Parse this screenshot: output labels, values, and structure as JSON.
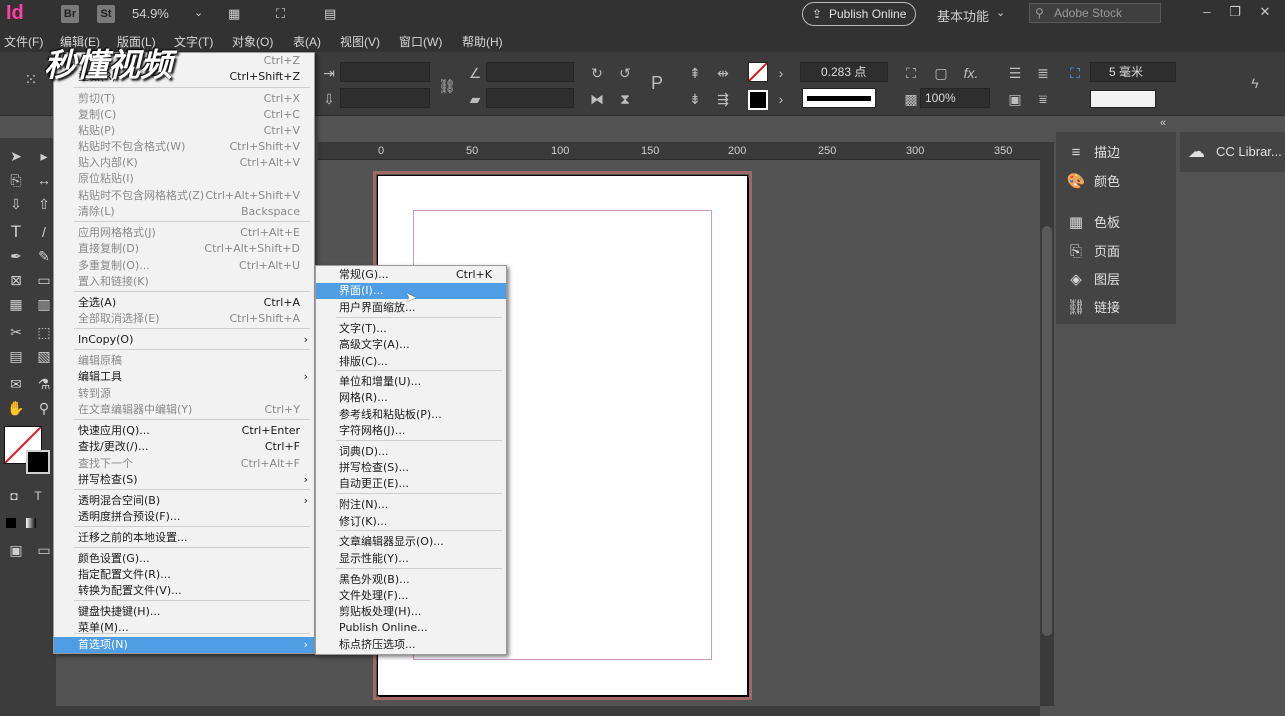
{
  "titlebar": {
    "zoom": "54.9%",
    "br_badge": "Br",
    "st_badge": "St",
    "publish_label": "Publish Online",
    "workspace": "基本功能",
    "search_placeholder": "Adobe Stock"
  },
  "menubar": [
    "文件(F)",
    "编辑(E)",
    "版面(L)",
    "文字(T)",
    "对象(O)",
    "表(A)",
    "视图(V)",
    "窗口(W)",
    "帮助(H)"
  ],
  "control": {
    "stroke_weight": "0.283 点",
    "opacity": "100%",
    "gutter": "5 毫米"
  },
  "ruler": [
    "0",
    "50",
    "100",
    "150",
    "200",
    "250",
    "300",
    "350"
  ],
  "panels": [
    "描边",
    "颜色",
    "色板",
    "页面",
    "图层",
    "链接"
  ],
  "cc_panel": "CC Librar...",
  "watermark": "秒懂视频",
  "edit_menu": {
    "items": [
      {
        "label": "",
        "shortcut": "Ctrl+Z",
        "disabled": true
      },
      {
        "label": "重做(R)",
        "shortcut": "Ctrl+Shift+Z",
        "disabled": false
      },
      {
        "label": "剪切(T)",
        "shortcut": "Ctrl+X",
        "disabled": true
      },
      {
        "label": "复制(C)",
        "shortcut": "Ctrl+C",
        "disabled": true
      },
      {
        "label": "粘贴(P)",
        "shortcut": "Ctrl+V",
        "disabled": true
      },
      {
        "label": "粘贴时不包含格式(W)",
        "shortcut": "Ctrl+Shift+V",
        "disabled": true
      },
      {
        "label": "贴入内部(K)",
        "shortcut": "Ctrl+Alt+V",
        "disabled": true
      },
      {
        "label": "原位粘贴(I)",
        "shortcut": "",
        "disabled": true
      },
      {
        "label": "粘贴时不包含网格格式(Z)",
        "shortcut": "Ctrl+Alt+Shift+V",
        "disabled": true
      },
      {
        "label": "清除(L)",
        "shortcut": "Backspace",
        "disabled": true
      },
      {
        "label": "应用网格格式(J)",
        "shortcut": "Ctrl+Alt+E",
        "disabled": true
      },
      {
        "label": "直接复制(D)",
        "shortcut": "Ctrl+Alt+Shift+D",
        "disabled": true
      },
      {
        "label": "多重复制(O)...",
        "shortcut": "Ctrl+Alt+U",
        "disabled": true
      },
      {
        "label": "置入和链接(K)",
        "shortcut": "",
        "disabled": true
      },
      {
        "label": "全选(A)",
        "shortcut": "Ctrl+A",
        "disabled": false
      },
      {
        "label": "全部取消选择(E)",
        "shortcut": "Ctrl+Shift+A",
        "disabled": true
      },
      {
        "label": "InCopy(O)",
        "shortcut": "",
        "disabled": false,
        "submenu": true
      },
      {
        "label": "编辑原稿",
        "shortcut": "",
        "disabled": true
      },
      {
        "label": "编辑工具",
        "shortcut": "",
        "disabled": false,
        "submenu": true
      },
      {
        "label": "转到源",
        "shortcut": "",
        "disabled": true
      },
      {
        "label": "在文章编辑器中编辑(Y)",
        "shortcut": "Ctrl+Y",
        "disabled": true
      },
      {
        "label": "快速应用(Q)...",
        "shortcut": "Ctrl+Enter",
        "disabled": false
      },
      {
        "label": "查找/更改(/)...",
        "shortcut": "Ctrl+F",
        "disabled": false
      },
      {
        "label": "查找下一个",
        "shortcut": "Ctrl+Alt+F",
        "disabled": true
      },
      {
        "label": "拼写检查(S)",
        "shortcut": "",
        "disabled": false,
        "submenu": true
      },
      {
        "label": "透明混合空间(B)",
        "shortcut": "",
        "disabled": false,
        "submenu": true
      },
      {
        "label": "透明度拼合预设(F)...",
        "shortcut": "",
        "disabled": false
      },
      {
        "label": "迁移之前的本地设置...",
        "shortcut": "",
        "disabled": false
      },
      {
        "label": "颜色设置(G)...",
        "shortcut": "",
        "disabled": false
      },
      {
        "label": "指定配置文件(R)...",
        "shortcut": "",
        "disabled": false
      },
      {
        "label": "转换为配置文件(V)...",
        "shortcut": "",
        "disabled": false
      },
      {
        "label": "键盘快捷键(H)...",
        "shortcut": "",
        "disabled": false
      },
      {
        "label": "菜单(M)...",
        "shortcut": "",
        "disabled": false
      },
      {
        "label": "首选项(N)",
        "shortcut": "",
        "disabled": false,
        "submenu": true,
        "highlight": true
      }
    ]
  },
  "pref_menu": {
    "items": [
      {
        "label": "常规(G)...",
        "shortcut": "Ctrl+K"
      },
      {
        "label": "界面(I)...",
        "shortcut": "",
        "highlight": true
      },
      {
        "label": "用户界面缩放...",
        "shortcut": ""
      },
      {
        "label": "文字(T)...",
        "shortcut": ""
      },
      {
        "label": "高级文字(A)...",
        "shortcut": ""
      },
      {
        "label": "排版(C)...",
        "shortcut": ""
      },
      {
        "label": "单位和增量(U)...",
        "shortcut": ""
      },
      {
        "label": "网格(R)...",
        "shortcut": ""
      },
      {
        "label": "参考线和粘贴板(P)...",
        "shortcut": ""
      },
      {
        "label": "字符网格(J)...",
        "shortcut": ""
      },
      {
        "label": "词典(D)...",
        "shortcut": ""
      },
      {
        "label": "拼写检查(S)...",
        "shortcut": ""
      },
      {
        "label": "自动更正(E)...",
        "shortcut": ""
      },
      {
        "label": "附注(N)...",
        "shortcut": ""
      },
      {
        "label": "修订(K)...",
        "shortcut": ""
      },
      {
        "label": "文章编辑器显示(O)...",
        "shortcut": ""
      },
      {
        "label": "显示性能(Y)...",
        "shortcut": ""
      },
      {
        "label": "黑色外观(B)...",
        "shortcut": ""
      },
      {
        "label": "文件处理(F)...",
        "shortcut": ""
      },
      {
        "label": "剪贴板处理(H)...",
        "shortcut": ""
      },
      {
        "label": "Publish Online...",
        "shortcut": ""
      },
      {
        "label": "标点挤压选项...",
        "shortcut": ""
      }
    ]
  }
}
